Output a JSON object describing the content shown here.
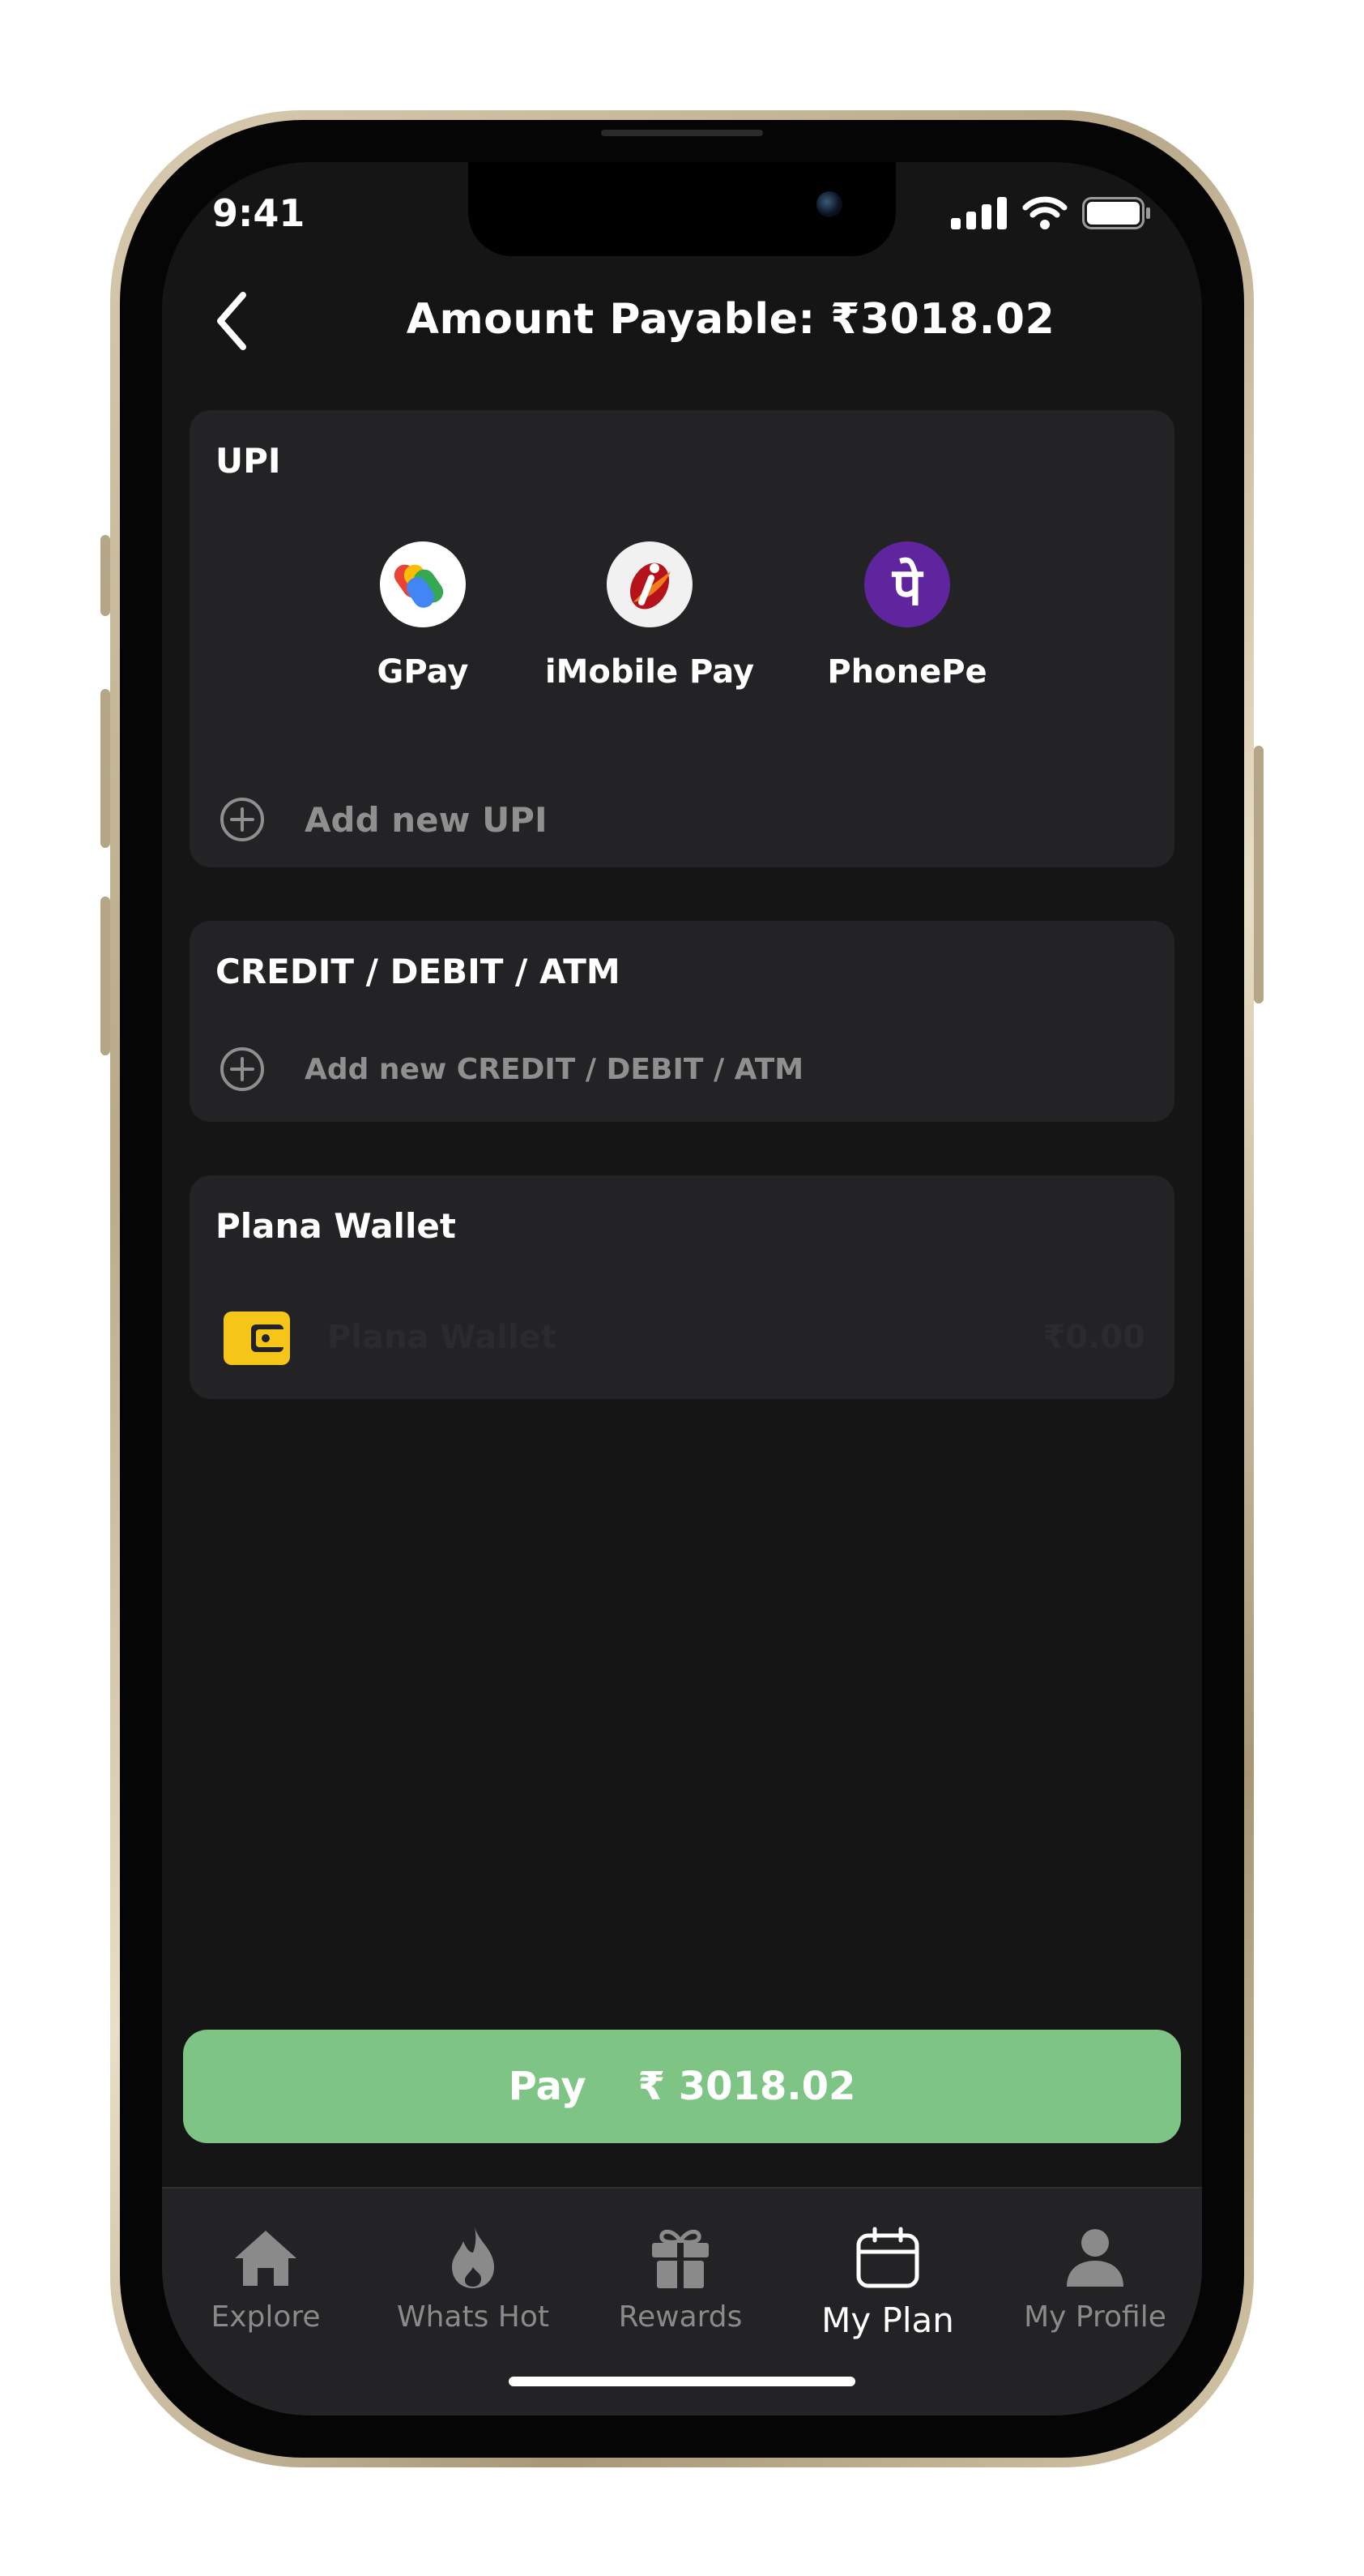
{
  "status_bar": {
    "time": "9:41"
  },
  "header": {
    "title": "Amount Payable: ₹3018.02"
  },
  "upi": {
    "title": "UPI",
    "apps": [
      {
        "label": "GPay",
        "icon": "gpay-icon"
      },
      {
        "label": "iMobile Pay",
        "icon": "imobile-icon"
      },
      {
        "label": "PhonePe",
        "icon": "phonepe-icon"
      }
    ],
    "add_label": "Add new UPI"
  },
  "card": {
    "title": "CREDIT / DEBIT / ATM",
    "add_label": "Add new CREDIT / DEBIT / ATM"
  },
  "wallet": {
    "title": "Plana Wallet",
    "label": "Plana Wallet",
    "amount": "₹0.00"
  },
  "pay_button": {
    "label": "Pay",
    "amount": "₹ 3018.02"
  },
  "tabs": [
    {
      "label": "Explore",
      "icon": "home-icon"
    },
    {
      "label": "Whats Hot",
      "icon": "flame-icon"
    },
    {
      "label": "Rewards",
      "icon": "gift-icon"
    },
    {
      "label": "My Plan",
      "icon": "calendar-icon",
      "active": true
    },
    {
      "label": "My Profile",
      "icon": "person-icon"
    }
  ],
  "colors": {
    "background": "#151515",
    "card": "#232325",
    "pay_button": "#7ec585",
    "wallet_icon": "#f5c518",
    "phonepe": "#5f259f"
  }
}
